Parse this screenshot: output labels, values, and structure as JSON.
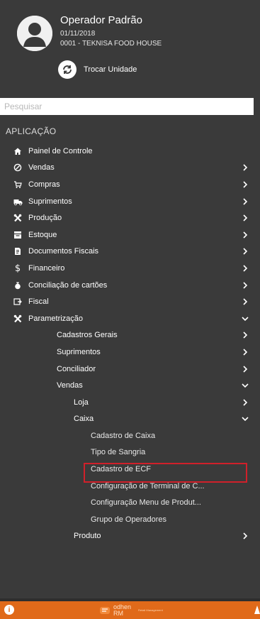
{
  "profile": {
    "name": "Operador Padrão",
    "date": "01/11/2018",
    "unit": "0001 - TEKNISA FOOD HOUSE",
    "switch_label": "Trocar Unidade"
  },
  "search": {
    "placeholder": "Pesquisar",
    "value": ""
  },
  "section_title": "APLICAÇÃO",
  "menu": [
    {
      "label": "Painel de Controle",
      "level": 0,
      "icon": "home-icon",
      "chevron": "none"
    },
    {
      "label": "Vendas",
      "level": 0,
      "icon": "sales-icon",
      "chevron": "right"
    },
    {
      "label": "Compras",
      "level": 0,
      "icon": "cart-icon",
      "chevron": "right"
    },
    {
      "label": "Suprimentos",
      "level": 0,
      "icon": "truck-icon",
      "chevron": "right"
    },
    {
      "label": "Produção",
      "level": 0,
      "icon": "tools-icon",
      "chevron": "right"
    },
    {
      "label": "Estoque",
      "level": 0,
      "icon": "stock-icon",
      "chevron": "right"
    },
    {
      "label": "Documentos Fiscais",
      "level": 0,
      "icon": "document-icon",
      "chevron": "right"
    },
    {
      "label": "Financeiro",
      "level": 0,
      "icon": "dollar-icon",
      "chevron": "right"
    },
    {
      "label": "Conciliação de cartões",
      "level": 0,
      "icon": "card-icon",
      "chevron": "right"
    },
    {
      "label": "Fiscal",
      "level": 0,
      "icon": "fiscal-icon",
      "chevron": "right"
    },
    {
      "label": "Parametrização",
      "level": 0,
      "icon": "tools-icon",
      "chevron": "down"
    },
    {
      "label": "Cadastros Gerais",
      "level": 1,
      "chevron": "right"
    },
    {
      "label": "Suprimentos",
      "level": 1,
      "chevron": "right"
    },
    {
      "label": "Conciliador",
      "level": 1,
      "chevron": "right"
    },
    {
      "label": "Vendas",
      "level": 1,
      "chevron": "down"
    },
    {
      "label": "Loja",
      "level": 2,
      "chevron": "right"
    },
    {
      "label": "Caixa",
      "level": 2,
      "chevron": "down"
    },
    {
      "label": "Cadastro de Caixa",
      "level": 3,
      "chevron": "none",
      "highlighted": true
    },
    {
      "label": "Tipo de Sangria",
      "level": 3,
      "chevron": "none"
    },
    {
      "label": "Cadastro de ECF",
      "level": 3,
      "chevron": "none"
    },
    {
      "label": "Configuração de Terminal de C...",
      "level": 3,
      "chevron": "none"
    },
    {
      "label": "Configuração Menu de Produt...",
      "level": 3,
      "chevron": "none"
    },
    {
      "label": "Grupo de Operadores",
      "level": 3,
      "chevron": "none"
    },
    {
      "label": "Produto",
      "level": 2,
      "chevron": "right"
    }
  ],
  "footer": {
    "brand": "odhen",
    "brand_sub": "RM",
    "brand_tag": "Retail Management"
  },
  "colors": {
    "sidebar_bg": "#3a3a3a",
    "footer_bg": "#e06a1a",
    "highlight": "#d0202a"
  }
}
